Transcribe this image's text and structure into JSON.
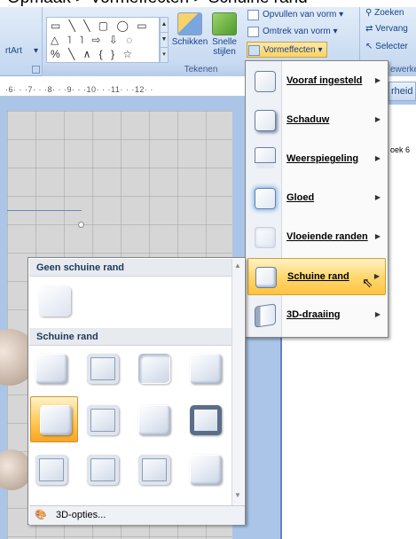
{
  "caption": "Opmaak > Vormeffecten > Schuine rand",
  "ribbon": {
    "smartart_label": "rtArt",
    "shape_rows": [
      "▭ ╲ ╲ ▢ ◯ ▭",
      "△ ˥ ˥ ⇨ ⇩ ◌",
      "% ╲ ∧ { } ☆"
    ],
    "arrange_label": "Schikken",
    "quick_styles_label": "Snelle stijlen",
    "shape_fill_label": "Opvullen van vorm",
    "shape_outline_label": "Omtrek van vorm",
    "shape_effects_label": "Vormeffecten",
    "group_drawing_label": "Tekenen",
    "find_label": "Zoeken",
    "replace_label": "Vervang",
    "select_label": "Selecter",
    "group_edit_label": "ewerke",
    "side_tab_label": "rheid",
    "side_note": "oek 6"
  },
  "ruler_text": "·6· · ·7· · ·8· · ·9· · ·10· · ·11· · ·12· ·",
  "fx_menu": {
    "items": [
      {
        "label": "Vooraf ingesteld"
      },
      {
        "label": "Schaduw"
      },
      {
        "label": "Weerspiegeling"
      },
      {
        "label": "Gloed"
      },
      {
        "label": "Vloeiende randen"
      },
      {
        "label": "Schuine rand"
      },
      {
        "label": "3D-draaiing"
      }
    ]
  },
  "bevel_gallery": {
    "section_none": "Geen schuine rand",
    "section_bevel": "Schuine rand",
    "footer_label": "3D-opties...",
    "selected_index": 4
  }
}
